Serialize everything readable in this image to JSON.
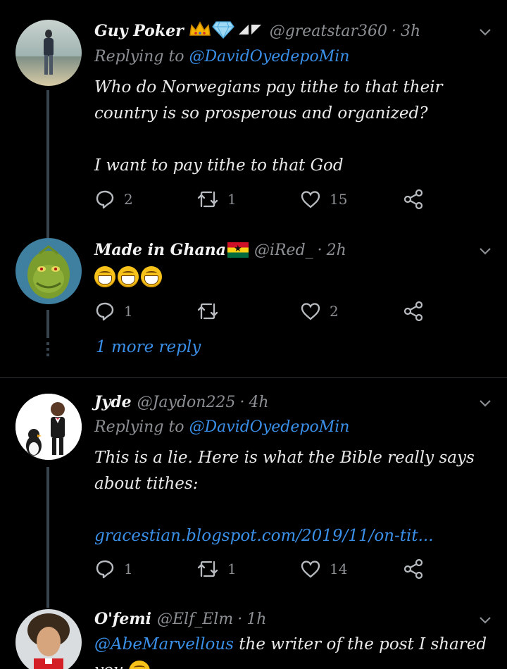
{
  "tweets": [
    {
      "name": "Guy Poker",
      "name_emojis": "👑💎◢◤",
      "handle": "@greatstar360",
      "sep": "·",
      "time": "3h",
      "replying_prefix": "Replying to",
      "replying_mention": "@DavidOyedepoMin",
      "body_line1": "Who do Norwegians pay tithe to that their country is so prosperous and organized?",
      "body_line2": "I want to pay tithe to that God",
      "replies": "2",
      "retweets": "1",
      "likes": "15"
    },
    {
      "name": "Made in Ghana",
      "handle": "@iRed_",
      "sep": "·",
      "time": "2h",
      "replies": "1",
      "retweets": "",
      "likes": "2"
    },
    {
      "name": "Jyde",
      "handle": "@Jaydon225",
      "sep": "·",
      "time": "4h",
      "replying_prefix": "Replying to",
      "replying_mention": "@DavidOyedepoMin",
      "body_line1": "This is a lie. Here is what the Bible really says about tithes:",
      "body_link": "gracestian.blogspot.com/2019/11/on-tit...",
      "replies": "1",
      "retweets": "1",
      "likes": "14"
    },
    {
      "name": "O'femi",
      "handle": "@Elf_Elm",
      "sep": "·",
      "time": "1h",
      "body_mention": "@AbeMarvellous",
      "body_text": " the writer of the post I shared",
      "body_line2": "you"
    }
  ],
  "more_reply": "1 more reply",
  "colors": {
    "background": "#000000",
    "link": "#3a8fe8",
    "secondary": "#8c8f93",
    "divider": "#2f3336"
  },
  "icons": [
    "reply-icon",
    "retweet-icon",
    "like-icon",
    "share-icon",
    "chevron-down-icon"
  ]
}
